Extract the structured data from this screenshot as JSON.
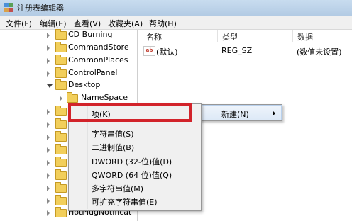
{
  "window": {
    "title": "注册表编辑器"
  },
  "menubar": [
    {
      "label": "文件(F)"
    },
    {
      "label": "编辑(E)"
    },
    {
      "label": "查看(V)"
    },
    {
      "label": "收藏夹(A)"
    },
    {
      "label": "帮助(H)"
    }
  ],
  "tree": {
    "items": [
      {
        "label": "CD Burning",
        "expanded": false
      },
      {
        "label": "CommandStore",
        "expanded": false
      },
      {
        "label": "CommonPlaces",
        "expanded": false
      },
      {
        "label": "ControlPanel",
        "expanded": false
      },
      {
        "label": "Desktop",
        "expanded": true
      },
      {
        "label": "NameSpace",
        "expanded": false
      },
      {
        "label": "HotPlugNotificat",
        "expanded": false
      }
    ]
  },
  "values_table": {
    "columns": [
      "名称",
      "类型",
      "数据"
    ],
    "rows": [
      {
        "icon": "string-value-icon",
        "name": "(默认)",
        "type": "REG_SZ",
        "data": "(数值未设置)"
      }
    ]
  },
  "parent_menu": {
    "label": "新建(N)"
  },
  "context_menu": {
    "items": [
      {
        "label": "项(K)"
      },
      {
        "label": "字符串值(S)"
      },
      {
        "label": "二进制值(B)"
      },
      {
        "label": "DWORD (32-位)值(D)"
      },
      {
        "label": "QWORD (64 位)值(Q)"
      },
      {
        "label": "多字符串值(M)"
      },
      {
        "label": "可扩充字符串值(E)"
      }
    ]
  },
  "annotation": {
    "color": "#d2232a"
  }
}
